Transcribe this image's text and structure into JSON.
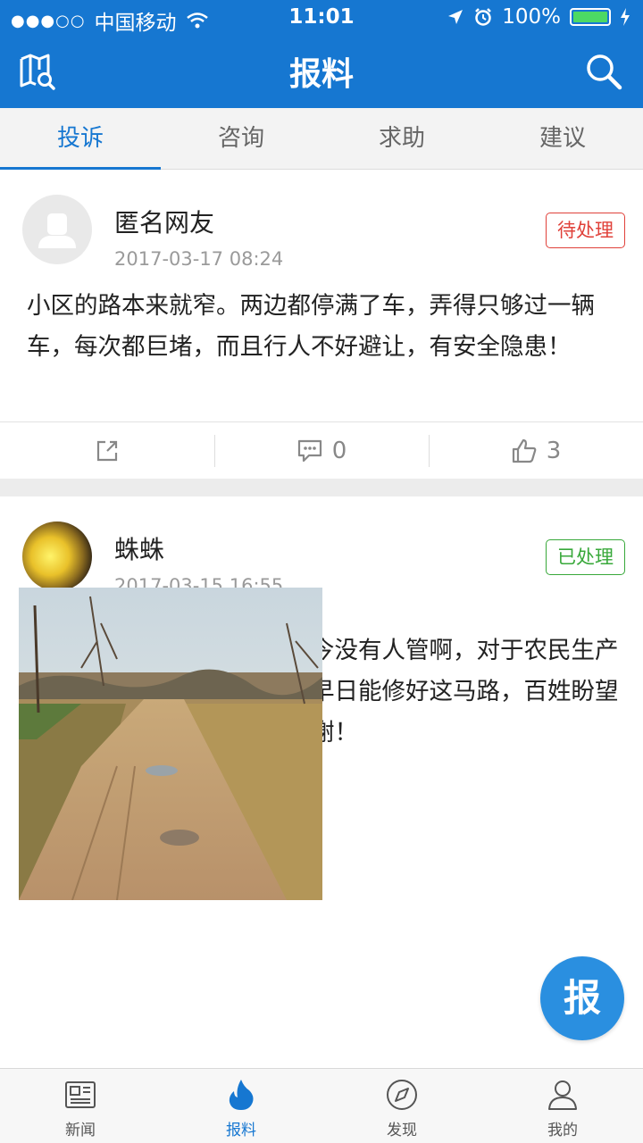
{
  "status_bar": {
    "signal_dots": "●●●○○",
    "carrier": "中国移动",
    "time": "11:01",
    "battery": "100%"
  },
  "header": {
    "title": "报料"
  },
  "tabs": [
    {
      "label": "投诉",
      "active": true
    },
    {
      "label": "咨询",
      "active": false
    },
    {
      "label": "求助",
      "active": false
    },
    {
      "label": "建议",
      "active": false
    }
  ],
  "posts": [
    {
      "user": "匿名网友",
      "time": "2017-03-17 08:24",
      "status": "待处理",
      "content": "小区的路本来就窄。两边都停满了车，弄得只够过一辆车，每次都巨堵，而且行人不好避让，有安全隐患！",
      "comments": "0",
      "likes": "3"
    },
    {
      "user": "蛛蛛",
      "time": "2017-03-15 16:55",
      "status": "已处理",
      "content": "我们村至今还是泥巴路，至今没有人管啊，对于农民生产生活，出行都不方便，希望早日能修好这马路，百姓盼望着，希望媒体报道一下，谢谢！"
    }
  ],
  "fab": {
    "label": "报"
  },
  "bottom_nav": [
    {
      "label": "新闻",
      "icon": "newspaper-icon"
    },
    {
      "label": "报料",
      "icon": "flame-icon",
      "active": true
    },
    {
      "label": "发现",
      "icon": "compass-icon"
    },
    {
      "label": "我的",
      "icon": "user-icon"
    }
  ],
  "colors": {
    "primary": "#1677d1",
    "pending": "#e0413a",
    "done": "#38a83a"
  }
}
